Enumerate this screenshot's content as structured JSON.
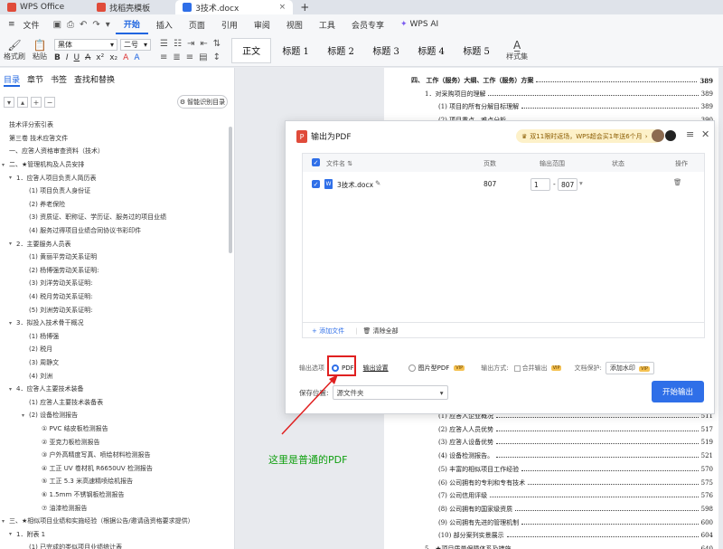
{
  "tabs": [
    {
      "label": "WPS Office",
      "color": "#e04b3a"
    },
    {
      "label": "找稻壳模板",
      "color": "#e04b3a"
    },
    {
      "label": "3技术.docx",
      "color": "#2f6fe8"
    }
  ],
  "new_tab": "+",
  "menu": {
    "file": "文件",
    "items": [
      "开始",
      "插入",
      "页面",
      "引用",
      "审阅",
      "视图",
      "工具",
      "会员专享"
    ],
    "ai": "WPS AI"
  },
  "ribbon": {
    "format_painter": "格式刷",
    "paste": "粘贴",
    "font_name": "黑体",
    "font_size": "二号",
    "styles": [
      "正文",
      "标题 1",
      "标题 2",
      "标题 3",
      "标题 4",
      "标题 5"
    ],
    "style_set": "样式集"
  },
  "nav": {
    "tabs": [
      "目录",
      "章节",
      "书签",
      "查找和替换"
    ],
    "smart_btn": "智能识别目录",
    "outline": [
      {
        "t": "技术评分索引表",
        "tri": ""
      },
      {
        "t": "第三卷    技术应答文件",
        "tri": ""
      },
      {
        "t": "一、应答人资格审查资料（技术）",
        "tri": ""
      },
      {
        "t": "二、★管理机构及人员安排",
        "tri": "▾"
      },
      {
        "t": "1．应答人项目负责人简历表",
        "tri": "▾"
      },
      {
        "t": "(1) 项目负责人身份证",
        "tri": ""
      },
      {
        "t": "(2) 养老保险",
        "tri": ""
      },
      {
        "t": "(3) 资质证、职称证、学历证、服务过的项目业绩",
        "tri": ""
      },
      {
        "t": "(4) 服务过得项目业绩合同协议书彩印件",
        "tri": ""
      },
      {
        "t": "2．主要服务人员表",
        "tri": "▾"
      },
      {
        "t": "(1) 黄丽平劳动关系证明",
        "tri": ""
      },
      {
        "t": "(2) 杨博强劳动关系证明:",
        "tri": ""
      },
      {
        "t": "(3) 刘洋劳动关系证明:",
        "tri": ""
      },
      {
        "t": "(4) 税月劳动关系证明:",
        "tri": ""
      },
      {
        "t": "(5) 刘洲劳动关系证明:",
        "tri": ""
      },
      {
        "t": "3．拟投入技术骨干概况",
        "tri": "▾"
      },
      {
        "t": "(1) 杨博强",
        "tri": ""
      },
      {
        "t": "(2) 税月",
        "tri": ""
      },
      {
        "t": "(3) 周静文",
        "tri": ""
      },
      {
        "t": "(4) 刘洲",
        "tri": ""
      },
      {
        "t": "4．应答人主要技术装备",
        "tri": "▾"
      },
      {
        "t": "(1) 应答人主要技术装备表",
        "tri": ""
      },
      {
        "t": "(2) 设备检测报告",
        "tri": "▾"
      },
      {
        "t": "① PVC 结皮板检测报告",
        "tri": ""
      },
      {
        "t": "② 亚克力板检测报告",
        "tri": ""
      },
      {
        "t": "③ 户外高精度写真、喷绘材料检测报告",
        "tri": ""
      },
      {
        "t": "④ 工正 UV 卷材机 R6650UV 检测报告",
        "tri": ""
      },
      {
        "t": "⑤ 工正 5.3 米高速精喷绘机报告",
        "tri": ""
      },
      {
        "t": "⑥ 1.5mm 不锈钢板检测报告",
        "tri": ""
      },
      {
        "t": "⑦ 油漆检测报告",
        "tri": ""
      },
      {
        "t": "三、★相似项目业绩和实施经验（根据公告/邀请函资格要求提供）",
        "tri": "▾"
      },
      {
        "t": "1．附表 1",
        "tri": "▾"
      },
      {
        "t": "(1) 已完成的类似项目业绩统计表",
        "tri": ""
      }
    ]
  },
  "doc": {
    "toc_top": [
      {
        "t": "四、 工作（服务）大纲、工作（服务）方案",
        "p": "389",
        "bold": true
      },
      {
        "t": "1．对采购项目的理解",
        "p": "389"
      },
      {
        "t": "(1) 项目的所有分解目标理解",
        "p": "389"
      },
      {
        "t": "(2) 项目重点、难点分析",
        "p": "390"
      }
    ],
    "toc_bottom": [
      {
        "t": "(1) 应答人企业概况",
        "p": "511"
      },
      {
        "t": "(2) 应答人人员优势",
        "p": "517"
      },
      {
        "t": "(3) 应答人设备优势",
        "p": "519"
      },
      {
        "t": "(4) 设备检测报告。",
        "p": "521"
      },
      {
        "t": "(5) 丰富的相似项目工作经验",
        "p": "570"
      },
      {
        "t": "(6) 公司拥有的专利和专有技术",
        "p": "575"
      },
      {
        "t": "(7) 公司信用评级",
        "p": "576"
      },
      {
        "t": "(8) 公司拥有的国家级资质",
        "p": "598"
      },
      {
        "t": "(9) 公司拥有先进的管理机制",
        "p": "600"
      },
      {
        "t": "(10) 部分案列实景展示",
        "p": "604"
      },
      {
        "t": "5．★项目质量保障体系及措施。",
        "p": "640"
      }
    ]
  },
  "dialog": {
    "title": "输出为PDF",
    "promo": "双11限时返场，WPS超会买1年送6个月",
    "headers": {
      "name": "文件名",
      "pages": "页数",
      "range": "输出范围",
      "status": "状态",
      "ops": "操作"
    },
    "file": {
      "name": "3技术.docx",
      "pages": "807",
      "from": "1",
      "to": "807",
      "sep": "-"
    },
    "add_file": "+ 添加文件",
    "clear_all": "清除全部",
    "output_options": "输出选项",
    "opt_pdf": "PDF",
    "output_settings": "输出设置",
    "opt_image_pdf": "图片型PDF",
    "output_mode": "输出方式:",
    "merge_output": "合并输出",
    "doc_protect": "文档保护:",
    "watermark": "添加水印",
    "save_location_label": "保存位置:",
    "save_location": "源文件夹",
    "start_button": "开始输出",
    "vip": "VIP"
  },
  "annotation": "这里是普通的PDF",
  "colors": {
    "accent": "#2f6fe8",
    "highlight": "#e02020",
    "annotation": "#10a010"
  }
}
